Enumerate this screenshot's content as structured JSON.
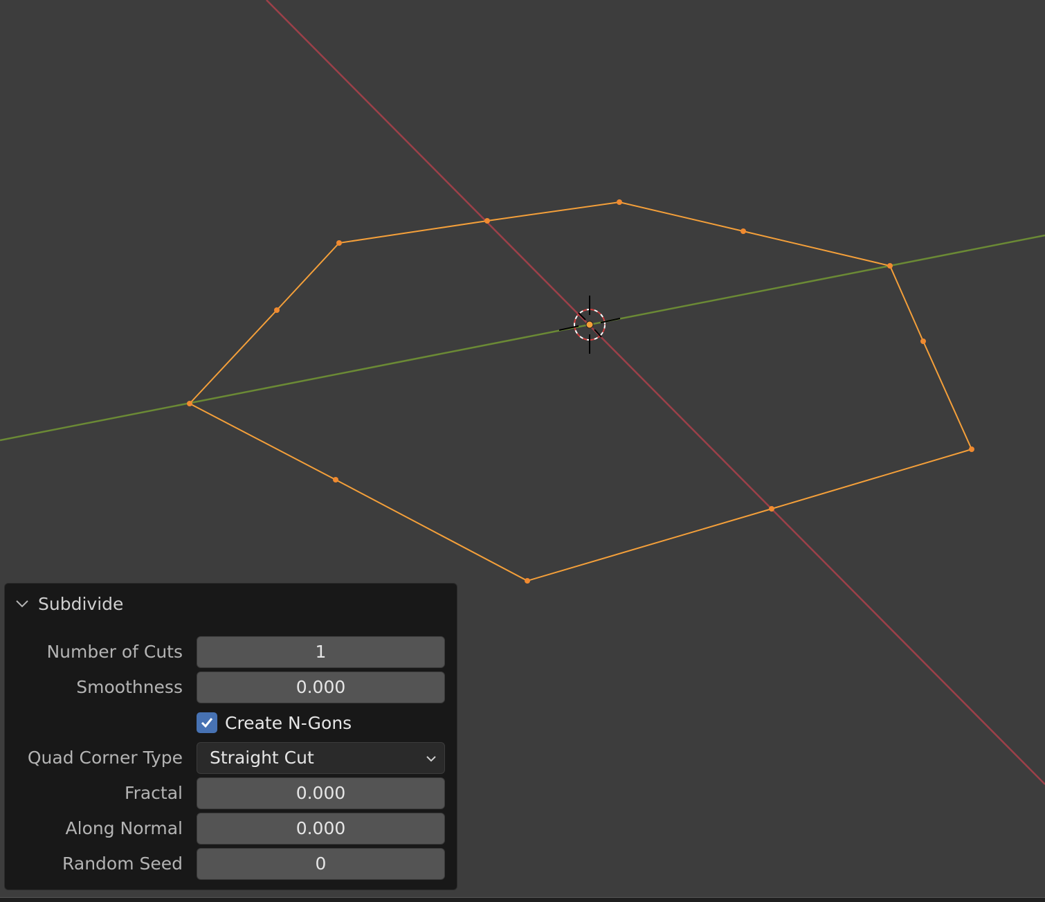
{
  "viewport": {
    "colors": {
      "background": "#3d3d3d",
      "x_axis": "#9c4049",
      "y_axis": "#6b8a35",
      "selected_edge": "#f5a03a",
      "selected_vertex": "#f08a30"
    },
    "cursor_icon": "3d-cursor-icon"
  },
  "operator_panel": {
    "title": "Subdivide",
    "expanded": true,
    "fields": {
      "number_of_cuts": {
        "label": "Number of Cuts",
        "value": "1"
      },
      "smoothness": {
        "label": "Smoothness",
        "value": "0.000"
      },
      "create_ngons": {
        "label": "Create N-Gons",
        "checked": true
      },
      "quad_corner_type": {
        "label": "Quad Corner Type",
        "value": "Straight Cut"
      },
      "fractal": {
        "label": "Fractal",
        "value": "0.000"
      },
      "along_normal": {
        "label": "Along Normal",
        "value": "0.000"
      },
      "random_seed": {
        "label": "Random Seed",
        "value": "0"
      }
    }
  }
}
